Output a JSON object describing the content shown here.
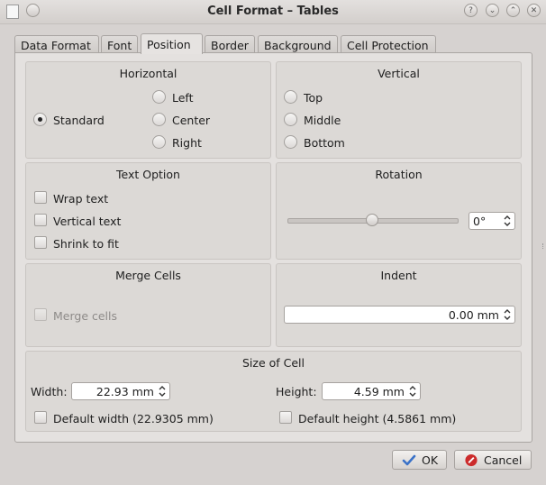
{
  "window": {
    "title": "Cell Format – Tables",
    "buttons": [
      "?",
      "⌄",
      "⌃",
      "✕"
    ]
  },
  "tabs": [
    {
      "label": "Data Format",
      "active": false
    },
    {
      "label": "Font",
      "active": false
    },
    {
      "label": "Position",
      "active": true
    },
    {
      "label": "Border",
      "active": false
    },
    {
      "label": "Background",
      "active": false
    },
    {
      "label": "Cell Protection",
      "active": false
    }
  ],
  "horizontal": {
    "title": "Horizontal",
    "options": [
      {
        "label": "Standard",
        "checked": true
      },
      {
        "label": "Left",
        "checked": false
      },
      {
        "label": "Center",
        "checked": false
      },
      {
        "label": "Right",
        "checked": false
      }
    ]
  },
  "vertical": {
    "title": "Vertical",
    "options": [
      {
        "label": "Top",
        "checked": false
      },
      {
        "label": "Middle",
        "checked": false
      },
      {
        "label": "Bottom",
        "checked": false
      }
    ]
  },
  "text_option": {
    "title": "Text Option",
    "wrap_text": "Wrap text",
    "vertical_text": "Vertical text",
    "shrink_to_fit": "Shrink to fit"
  },
  "rotation": {
    "title": "Rotation",
    "value": "0°",
    "slider_fraction": 0.5
  },
  "merge_cells": {
    "title": "Merge Cells",
    "label": "Merge cells",
    "enabled": false
  },
  "indent": {
    "title": "Indent",
    "value": "0.00 mm"
  },
  "size_of_cell": {
    "title": "Size of Cell",
    "width_label": "Width:",
    "width_value": "22.93 mm",
    "height_label": "Height:",
    "height_value": "4.59 mm",
    "default_width": "Default width (22.9305 mm)",
    "default_height": "Default height (4.5861 mm)"
  },
  "footer": {
    "ok_label": "OK",
    "cancel_label": "Cancel"
  },
  "colors": {
    "background": "#d6d2d0",
    "ok_icon": "#3a72c8",
    "cancel_icon": "#cc2b2b"
  }
}
